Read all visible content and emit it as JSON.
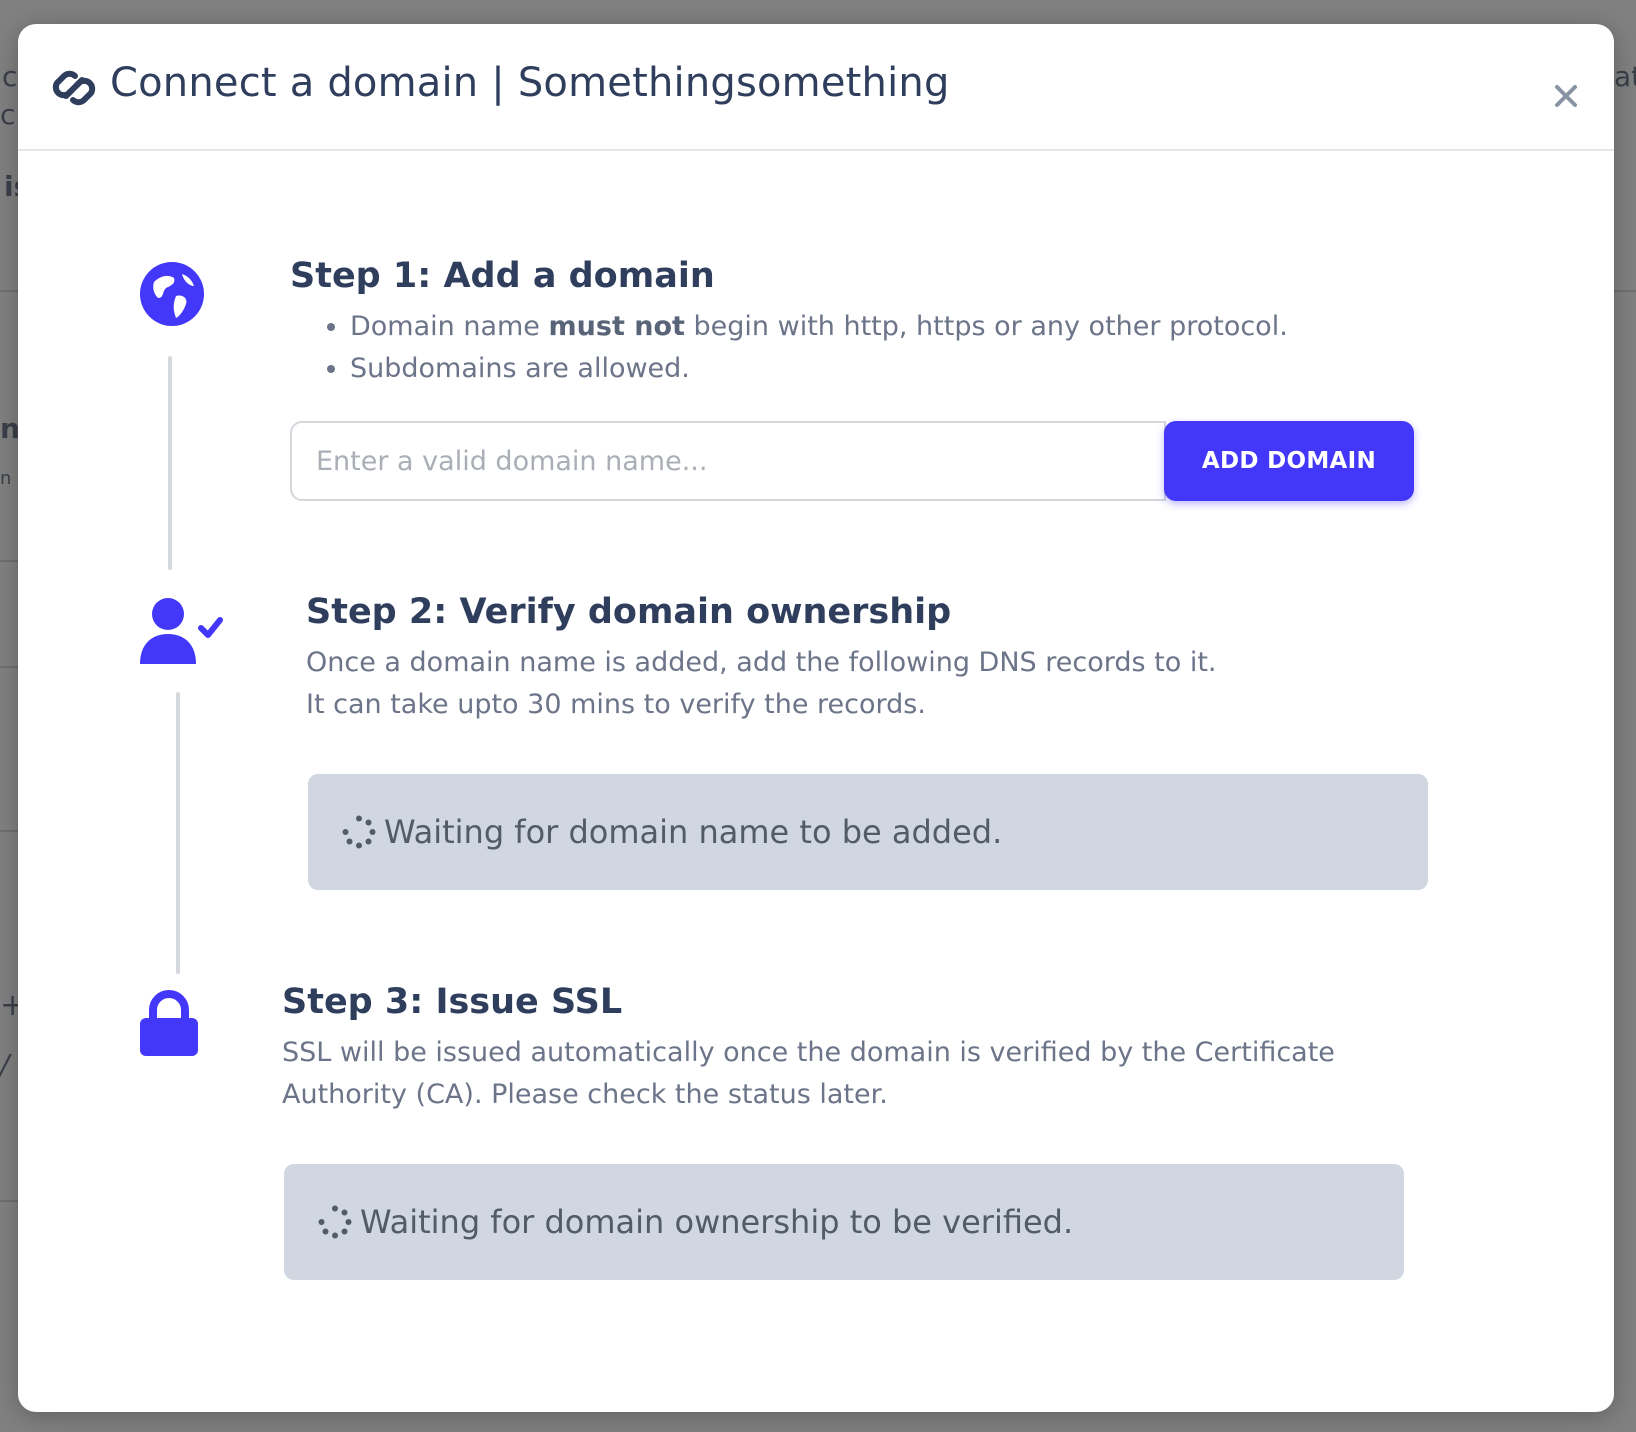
{
  "background": {
    "fragments": [
      "c",
      "cl",
      "is",
      "n",
      "n",
      "+",
      "/",
      "at"
    ]
  },
  "modal": {
    "title": "Connect a domain | Somethingsomething",
    "header_icon": "link-icon",
    "close_icon": "close-icon"
  },
  "steps": [
    {
      "icon": "globe-icon",
      "title": "Step 1: Add a domain",
      "bullets": [
        {
          "before": "Domain name ",
          "bold": "must not",
          "after": " begin with http, https or any other protocol."
        },
        {
          "text": "Subdomains are allowed."
        }
      ],
      "input_placeholder": "Enter a valid domain name...",
      "input_value": "",
      "button_label": "ADD DOMAIN"
    },
    {
      "icon": "user-check-icon",
      "title": "Step 2: Verify domain ownership",
      "lines": [
        "Once a domain name is added, add the following DNS records to it.",
        "It can take upto 30 mins to verify the records."
      ],
      "status_icon": "spinner-icon",
      "status": "Waiting for domain name to be added."
    },
    {
      "icon": "lock-icon",
      "title": "Step 3: Issue SSL",
      "text": "SSL will be issued automatically once the domain is verified by the Certificate Authority (CA). Please check the status later.",
      "status_icon": "spinner-icon",
      "status": "Waiting for domain ownership to be verified."
    }
  ],
  "colors": {
    "accent": "#4337fa",
    "heading": "#2f3e5c",
    "body_text": "#6b7488",
    "status_bg": "#d1d7e0",
    "overlay": "#808080"
  }
}
